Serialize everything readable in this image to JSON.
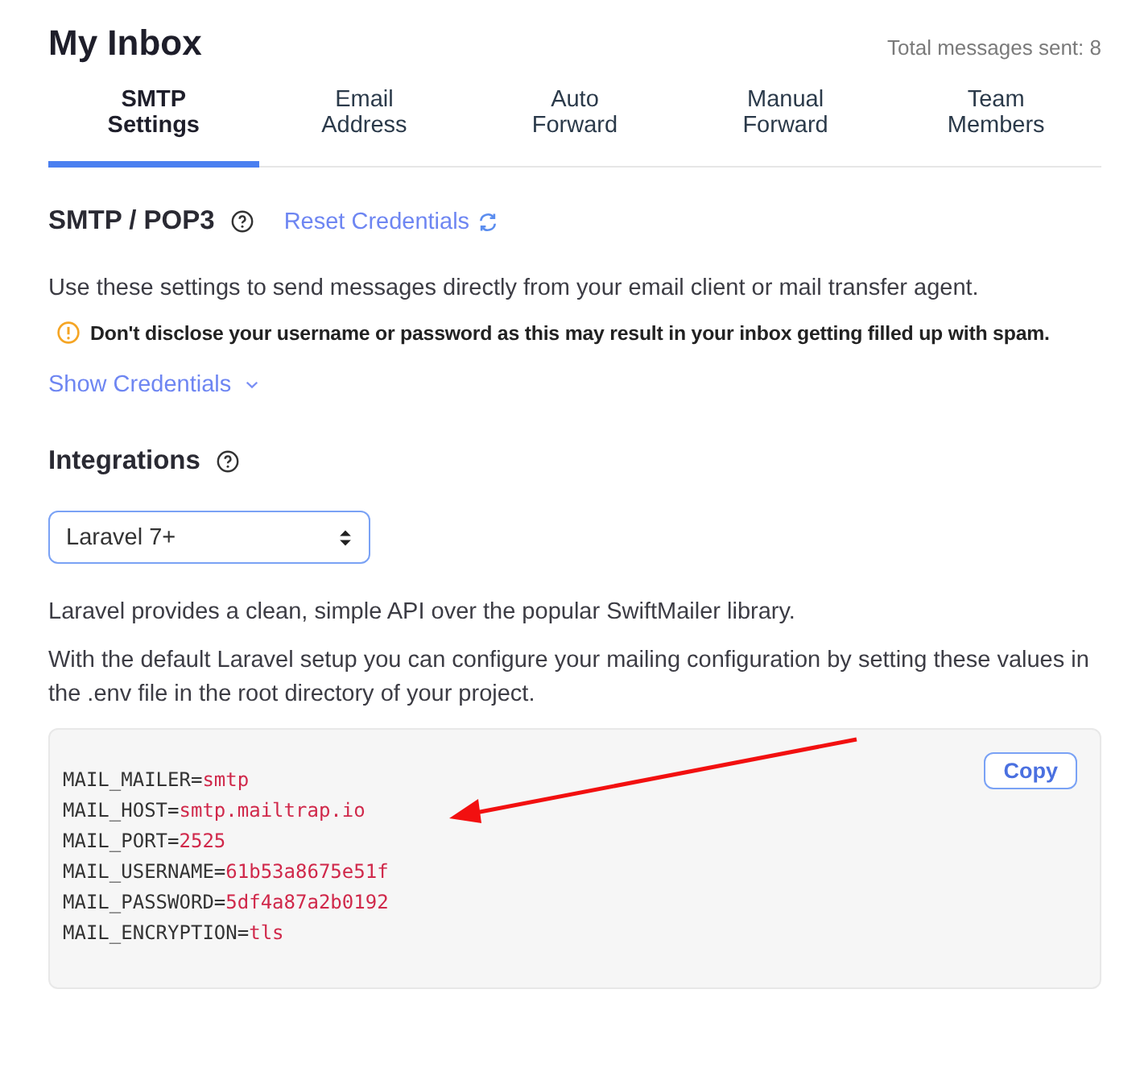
{
  "header": {
    "title": "My Inbox",
    "stat": "Total messages sent: 8"
  },
  "tabs": [
    {
      "label": "SMTP\nSettings",
      "selected": true
    },
    {
      "label": "Email\nAddress",
      "selected": false
    },
    {
      "label": "Auto\nForward",
      "selected": false
    },
    {
      "label": "Manual\nForward",
      "selected": false
    },
    {
      "label": "Team\nMembers",
      "selected": false
    }
  ],
  "smtp": {
    "heading": "SMTP / POP3",
    "reset_link": "Reset Credentials",
    "description": "Use these settings to send messages directly from your email client or mail transfer agent.",
    "warning": "Don't disclose your username or password as this may result in your inbox getting filled up with spam.",
    "show_credentials": "Show Credentials"
  },
  "integrations": {
    "heading": "Integrations",
    "select": {
      "value": "Laravel 7+"
    },
    "paragraphs": [
      "Laravel provides a clean, simple API over the popular SwiftMailer library.",
      "With the default Laravel setup you can configure your mailing configuration by setting these values in the .env file in the root directory of your project."
    ]
  },
  "code": {
    "copy_button": "Copy",
    "lines": [
      {
        "key": "MAIL_MAILER=",
        "value": "smtp"
      },
      {
        "key": "MAIL_HOST=",
        "value": "smtp.mailtrap.io"
      },
      {
        "key": "MAIL_PORT=",
        "value": "2525"
      },
      {
        "key": "MAIL_USERNAME=",
        "value": "61b53a8675e51f"
      },
      {
        "key": "MAIL_PASSWORD=",
        "value": "5df4a87a2b0192"
      },
      {
        "key": "MAIL_ENCRYPTION=",
        "value": "tls"
      }
    ]
  }
}
